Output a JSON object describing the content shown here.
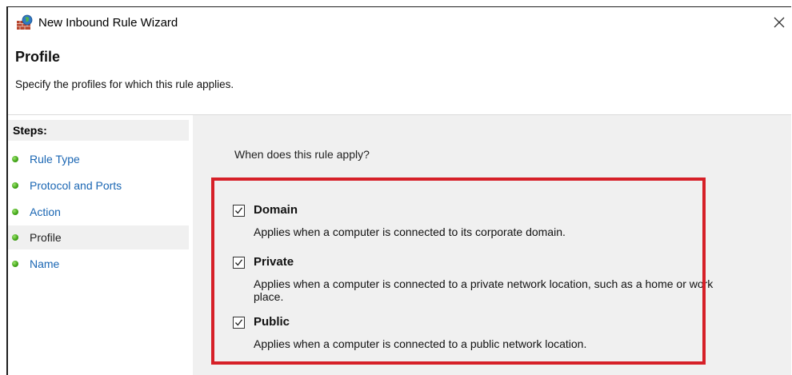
{
  "window": {
    "title": "New Inbound Rule Wizard",
    "close_glyph": "✕"
  },
  "header": {
    "title": "Profile",
    "description": "Specify the profiles for which this rule applies."
  },
  "steps": {
    "heading": "Steps:",
    "items": [
      {
        "label": "Rule Type",
        "active": false
      },
      {
        "label": "Protocol and Ports",
        "active": false
      },
      {
        "label": "Action",
        "active": false
      },
      {
        "label": "Profile",
        "active": true
      },
      {
        "label": "Name",
        "active": false
      }
    ]
  },
  "content": {
    "question": "When does this rule apply?",
    "options": [
      {
        "label": "Domain",
        "checked": true,
        "description": "Applies when a computer is connected to its corporate domain."
      },
      {
        "label": "Private",
        "checked": true,
        "description": "Applies when a computer is connected to a private network location, such as a home or work place."
      },
      {
        "label": "Public",
        "checked": true,
        "description": "Applies when a computer is connected to a public network location."
      }
    ]
  },
  "colors": {
    "link": "#1a66b3",
    "highlight_border": "#d62028",
    "content_bg": "#f0f0f0",
    "step_dot": "#45a81a"
  },
  "icons": {
    "app": "firewall-brick-globe-icon",
    "close": "close-icon",
    "step": "green-dot-icon",
    "check": "checkmark-icon"
  }
}
